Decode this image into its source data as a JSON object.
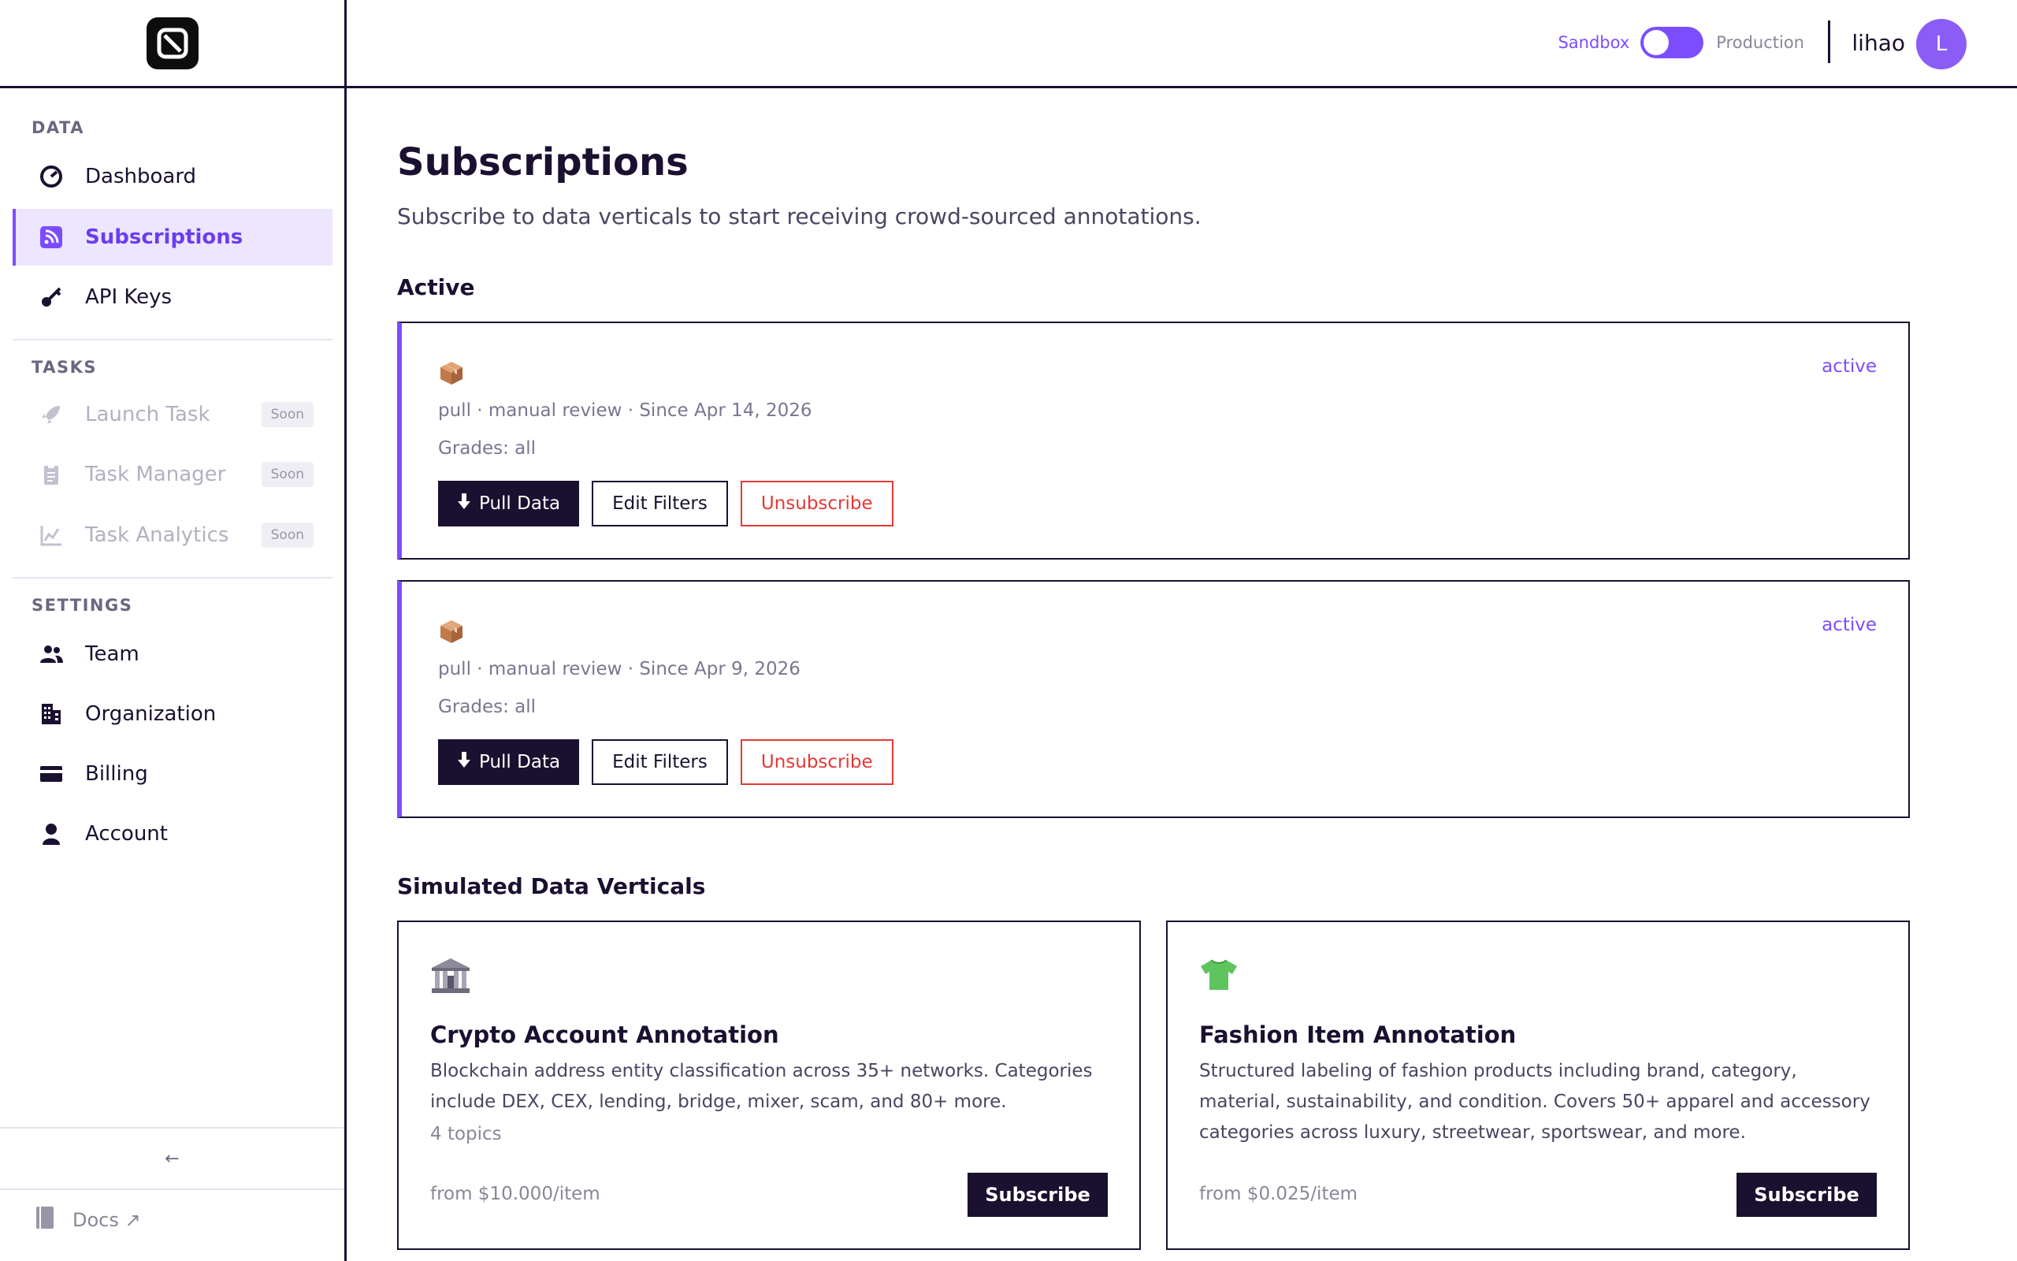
{
  "sidebar": {
    "sections": {
      "data": "DATA",
      "tasks": "TASKS",
      "settings": "SETTINGS"
    },
    "items": {
      "dashboard": "Dashboard",
      "subscriptions": "Subscriptions",
      "api_keys": "API Keys",
      "launch_task": "Launch Task",
      "task_manager": "Task Manager",
      "task_analytics": "Task Analytics",
      "team": "Team",
      "organization": "Organization",
      "billing": "Billing",
      "account": "Account"
    },
    "soon_badge": "Soon",
    "collapse_glyph": "←",
    "docs_label": "Docs ↗"
  },
  "header": {
    "env_sandbox": "Sandbox",
    "env_production": "Production",
    "username": "lihao",
    "avatar_initial": "L"
  },
  "main": {
    "title": "Subscriptions",
    "subtitle": "Subscribe to data verticals to start receiving crowd-sourced annotations.",
    "active_heading": "Active",
    "active_subscriptions": [
      {
        "status": "active",
        "meta": "pull · manual review · Since Apr 14, 2026",
        "grades": "Grades: all"
      },
      {
        "status": "active",
        "meta": "pull · manual review · Since Apr 9, 2026",
        "grades": "Grades: all"
      }
    ],
    "buttons": {
      "pull": "Pull Data",
      "edit": "Edit Filters",
      "unsubscribe": "Unsubscribe",
      "subscribe": "Subscribe"
    },
    "verticals_heading": "Simulated Data Verticals",
    "verticals": [
      {
        "title": "Crypto Account Annotation",
        "description": "Blockchain address entity classification across 35+ networks. Categories include DEX, CEX, lending, bridge, mixer, scam, and 80+ more.",
        "topics": "4 topics",
        "price": "from $10.000/item"
      },
      {
        "title": "Fashion Item Annotation",
        "description": "Structured labeling of fashion products including brand, category, material, sustainability, and condition. Covers 50+ apparel and accessory categories across luxury, streetwear, sportswear, and more.",
        "topics": "",
        "price": "from $0.025/item"
      }
    ]
  },
  "colors": {
    "accent": "#7c4dff",
    "dark": "#1a1030",
    "danger": "#e53935"
  }
}
